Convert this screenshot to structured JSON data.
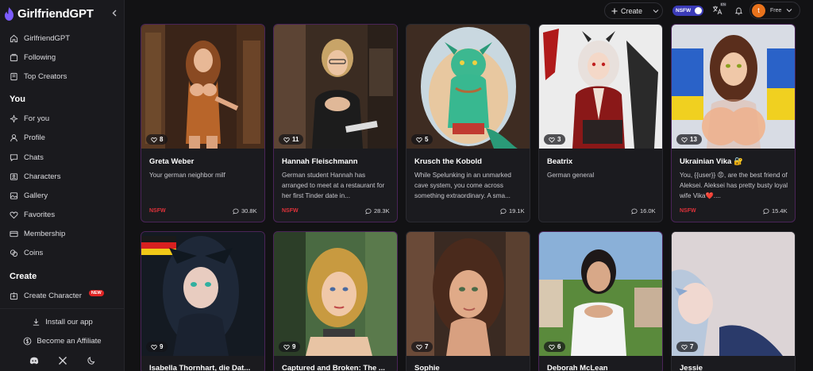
{
  "app": {
    "logo_text": "GirlfriendGPT"
  },
  "sidebar": {
    "top_items": [
      {
        "label": "GirlfriendGPT",
        "icon": "home-icon"
      },
      {
        "label": "Following",
        "icon": "following-icon"
      },
      {
        "label": "Top Creators",
        "icon": "bookmark-icon"
      }
    ],
    "you_heading": "You",
    "you_items": [
      {
        "label": "For you",
        "icon": "sparkle-icon"
      },
      {
        "label": "Profile",
        "icon": "user-icon"
      },
      {
        "label": "Chats",
        "icon": "chat-icon"
      },
      {
        "label": "Characters",
        "icon": "characters-icon"
      },
      {
        "label": "Gallery",
        "icon": "gallery-icon"
      },
      {
        "label": "Favorites",
        "icon": "heart-icon"
      },
      {
        "label": "Membership",
        "icon": "card-icon"
      },
      {
        "label": "Coins",
        "icon": "coins-icon"
      }
    ],
    "create_heading": "Create",
    "create_item": {
      "label": "Create Character",
      "badge": "NEW",
      "icon": "create-icon"
    },
    "install_label": "Install our app",
    "affiliate_label": "Become an Affiliate"
  },
  "topbar": {
    "create_label": "Create",
    "nsfw_label": "NSFW",
    "lang_badge": "EN",
    "avatar_letter": "t",
    "plan_label": "Free"
  },
  "cards": [
    {
      "title": "Greta Weber",
      "desc": "Your german neighbor milf",
      "likes": "8",
      "nsfw": "NSFW",
      "chats": "30.8K"
    },
    {
      "title": "Hannah Fleischmann",
      "desc": "German student Hannah has arranged to meet at a restaurant for her first Tinder date in...",
      "likes": "11",
      "nsfw": "NSFW",
      "chats": "28.3K"
    },
    {
      "title": "Krusch the Kobold",
      "desc": "While Spelunking in an unmarked cave system, you come across something extraordinary. A sma...",
      "likes": "5",
      "nsfw": "",
      "chats": "19.1K"
    },
    {
      "title": "Beatrix",
      "desc": "German general",
      "likes": "3",
      "nsfw": "",
      "chats": "16.0K"
    },
    {
      "title": "Ukrainian Vika 🔐",
      "desc": "You, {{user}} 😡, are the best friend of Aleksei. Aleksei has pretty busty loyal wife Vika❤️....",
      "likes": "13",
      "nsfw": "NSFW",
      "chats": "15.4K"
    }
  ],
  "cards_row2": [
    {
      "title": "Isabella Thornhart, die Dat...",
      "likes": "9"
    },
    {
      "title": "Captured and Broken: The ...",
      "likes": "9"
    },
    {
      "title": "Sophie",
      "likes": "7"
    },
    {
      "title": "Deborah McLean",
      "likes": "6"
    },
    {
      "title": "Jessie",
      "likes": "7"
    }
  ]
}
